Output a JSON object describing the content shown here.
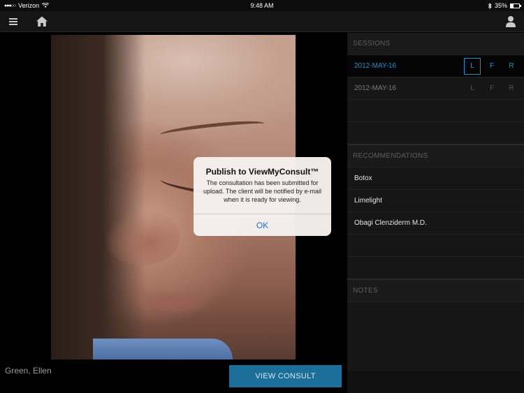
{
  "status_bar": {
    "carrier": "Verizon",
    "time": "9:48 AM",
    "battery": "35%",
    "battery_level": 0.35,
    "signal_icon": "signal-dots",
    "wifi_icon": "wifi-icon",
    "bluetooth_icon": "bluetooth-icon"
  },
  "nav": {
    "menu_icon": "hamburger-icon",
    "home_icon": "home-icon",
    "user_icon": "user-icon"
  },
  "client": {
    "name": "Green, Ellen"
  },
  "view_consult_label": "VIEW CONSULT",
  "sessions": {
    "header": "SESSIONS",
    "items": [
      {
        "date": "2012-MAY-16",
        "buttons": [
          "L",
          "F",
          "R"
        ],
        "active": true,
        "selected": "L"
      },
      {
        "date": "2012-MAY-16",
        "buttons": [
          "L",
          "F",
          "R"
        ],
        "active": false
      }
    ]
  },
  "recommendations": {
    "header": "RECOMMENDATIONS",
    "items": [
      "Botox",
      "Limelight",
      "Obagi Clenziderm M.D."
    ]
  },
  "notes": {
    "header": "NOTES"
  },
  "alert": {
    "title": "Publish to ViewMyConsult™",
    "message": "The consultation has been submitted for upload. The client will be notified by e-mail when it is ready for viewing.",
    "ok_label": "OK"
  },
  "colors": {
    "accent": "#1e8fc9",
    "button_bg": "#1c6f99",
    "alert_link": "#1a73d9"
  }
}
